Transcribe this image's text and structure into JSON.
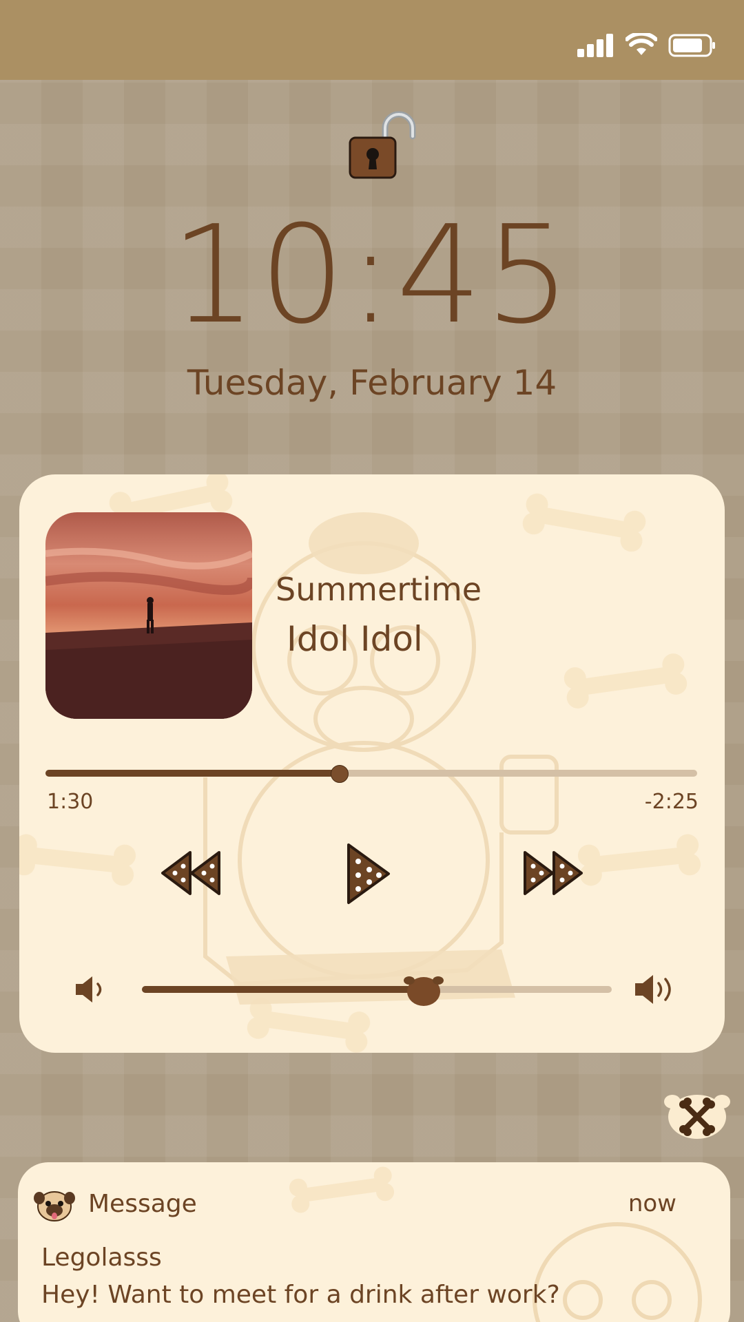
{
  "status_bar": {
    "signal_icon": "cellular-signal-icon",
    "wifi_icon": "wifi-icon",
    "battery_icon": "battery-icon"
  },
  "lock": {
    "icon": "padlock-unlocked-icon"
  },
  "clock": {
    "time": "10:45",
    "date": "Tuesday, February 14"
  },
  "player": {
    "song_title": "Summertime",
    "artist": "Idol Idol",
    "album_art": "sunset-silhouette-artwork",
    "elapsed": "1:30",
    "remaining": "-2:25",
    "progress_fraction": 0.45,
    "volume_fraction": 0.6,
    "controls": [
      "rewind-icon",
      "play-icon",
      "fast-forward-icon"
    ],
    "colors": {
      "accent": "#6c4424",
      "track": "#d4c0a6",
      "card": "#fdf1da"
    }
  },
  "settings_button": {
    "icon": "crossed-bones-icon"
  },
  "notification": {
    "app": "Message",
    "time": "now",
    "sender": "Legolasss",
    "body": "Hey! Want to meet for a drink after work?",
    "avatar_icon": "pug-avatar-icon"
  }
}
